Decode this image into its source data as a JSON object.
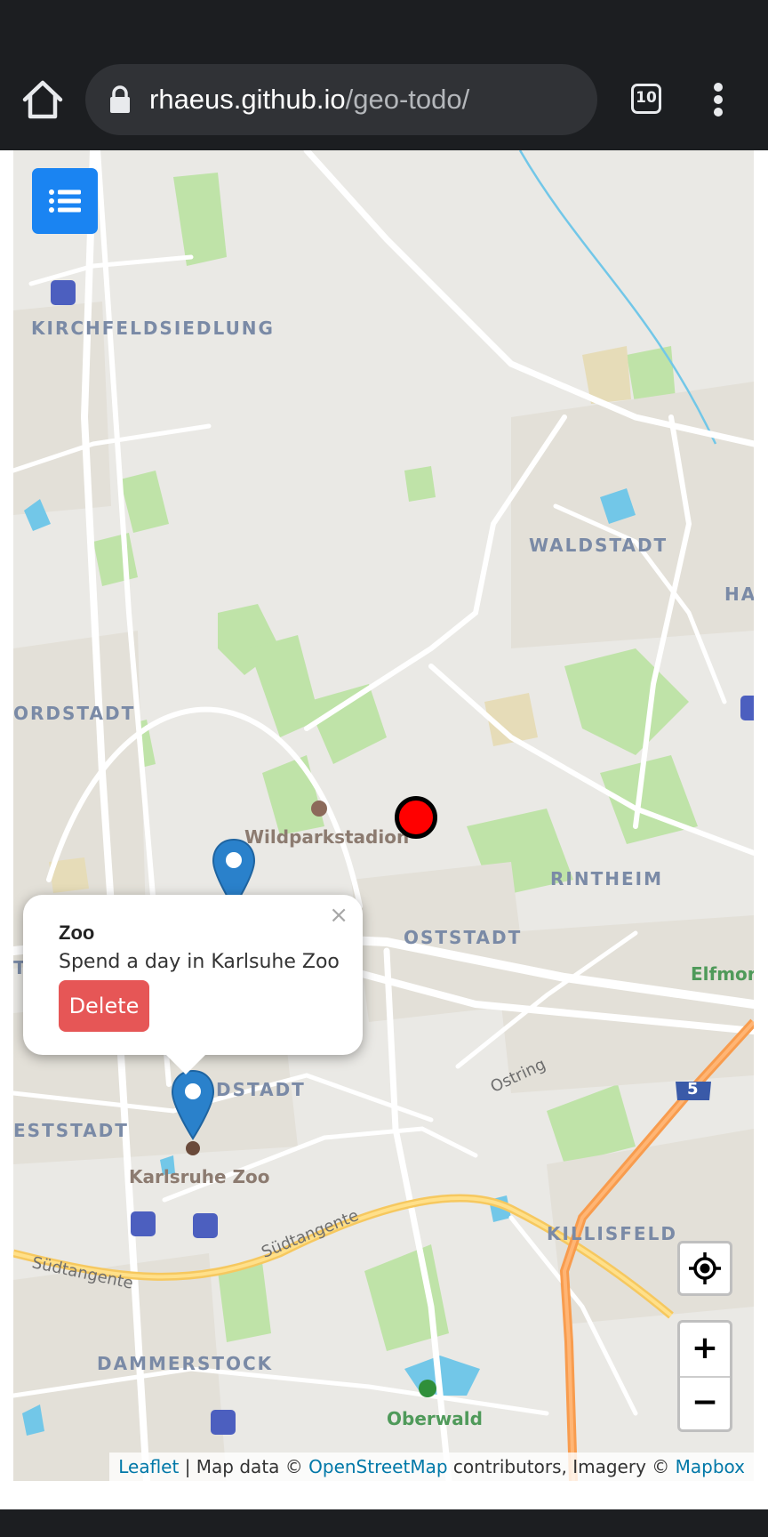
{
  "browser": {
    "url_host": "rhaeus.github.io",
    "url_path": "/geo-todo/",
    "tab_count": "10"
  },
  "map": {
    "labels": {
      "kirchfeldsiedlung": "KIRCHFELDSIEDLUNG",
      "waldstadt": "WALDSTADT",
      "ha": "HA",
      "nordstadt": "ORDSTADT",
      "wildparkstadion": "Wildparkstadion",
      "rintheim": "RINTHEIM",
      "oststadt": "OSTSTADT",
      "elfmorgen": "Elfmor",
      "ostring": "Ostring",
      "a5": "5",
      "weststadt_cut": "DSTADT",
      "estadt": "ESTSTADT",
      "karlsruhe_zoo": "Karlsruhe Zoo",
      "suedtangente_1": "Südtangente",
      "suedtangente_2": "Südtangente",
      "killisfeld": "KILLISFELD",
      "dammerstock": "DAMMERSTOCK",
      "oberwald": "Oberwald",
      "t_cut": "T"
    },
    "popup": {
      "close": "×",
      "title": "Zoo",
      "description": "Spend a day in Karlsuhe Zoo",
      "delete_label": "Delete"
    },
    "zoom": {
      "in": "+",
      "out": "−"
    },
    "attribution": {
      "leaflet": "Leaflet",
      "sep1": " | Map data © ",
      "osm": "OpenStreetMap",
      "sep2": " contributors, Imagery © ",
      "mapbox": "Mapbox"
    }
  },
  "icons": {
    "home": "home-icon",
    "lock": "lock-icon",
    "tabs": "tab-switcher-icon",
    "menu": "more-vert-icon",
    "list": "list-icon",
    "marker": "map-marker-icon",
    "locate": "locate-icon"
  },
  "colors": {
    "marker_blue": "#2a81cb",
    "user_dot": "#ff0000",
    "delete_button": "#e65656",
    "list_button": "#1a84f2",
    "link": "#0078a8"
  }
}
